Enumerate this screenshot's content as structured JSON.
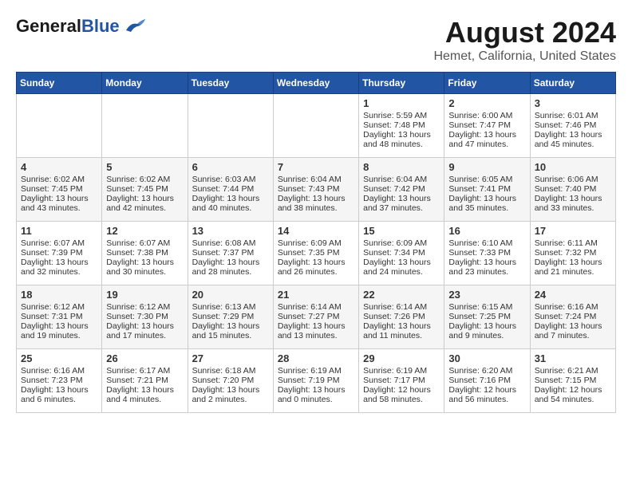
{
  "header": {
    "logo_line1": "General",
    "logo_line2": "Blue",
    "title": "August 2024",
    "subtitle": "Hemet, California, United States"
  },
  "days_of_week": [
    "Sunday",
    "Monday",
    "Tuesday",
    "Wednesday",
    "Thursday",
    "Friday",
    "Saturday"
  ],
  "weeks": [
    [
      {
        "day": "",
        "content": ""
      },
      {
        "day": "",
        "content": ""
      },
      {
        "day": "",
        "content": ""
      },
      {
        "day": "",
        "content": ""
      },
      {
        "day": "1",
        "content": "Sunrise: 5:59 AM\nSunset: 7:48 PM\nDaylight: 13 hours\nand 48 minutes."
      },
      {
        "day": "2",
        "content": "Sunrise: 6:00 AM\nSunset: 7:47 PM\nDaylight: 13 hours\nand 47 minutes."
      },
      {
        "day": "3",
        "content": "Sunrise: 6:01 AM\nSunset: 7:46 PM\nDaylight: 13 hours\nand 45 minutes."
      }
    ],
    [
      {
        "day": "4",
        "content": "Sunrise: 6:02 AM\nSunset: 7:45 PM\nDaylight: 13 hours\nand 43 minutes."
      },
      {
        "day": "5",
        "content": "Sunrise: 6:02 AM\nSunset: 7:45 PM\nDaylight: 13 hours\nand 42 minutes."
      },
      {
        "day": "6",
        "content": "Sunrise: 6:03 AM\nSunset: 7:44 PM\nDaylight: 13 hours\nand 40 minutes."
      },
      {
        "day": "7",
        "content": "Sunrise: 6:04 AM\nSunset: 7:43 PM\nDaylight: 13 hours\nand 38 minutes."
      },
      {
        "day": "8",
        "content": "Sunrise: 6:04 AM\nSunset: 7:42 PM\nDaylight: 13 hours\nand 37 minutes."
      },
      {
        "day": "9",
        "content": "Sunrise: 6:05 AM\nSunset: 7:41 PM\nDaylight: 13 hours\nand 35 minutes."
      },
      {
        "day": "10",
        "content": "Sunrise: 6:06 AM\nSunset: 7:40 PM\nDaylight: 13 hours\nand 33 minutes."
      }
    ],
    [
      {
        "day": "11",
        "content": "Sunrise: 6:07 AM\nSunset: 7:39 PM\nDaylight: 13 hours\nand 32 minutes."
      },
      {
        "day": "12",
        "content": "Sunrise: 6:07 AM\nSunset: 7:38 PM\nDaylight: 13 hours\nand 30 minutes."
      },
      {
        "day": "13",
        "content": "Sunrise: 6:08 AM\nSunset: 7:37 PM\nDaylight: 13 hours\nand 28 minutes."
      },
      {
        "day": "14",
        "content": "Sunrise: 6:09 AM\nSunset: 7:35 PM\nDaylight: 13 hours\nand 26 minutes."
      },
      {
        "day": "15",
        "content": "Sunrise: 6:09 AM\nSunset: 7:34 PM\nDaylight: 13 hours\nand 24 minutes."
      },
      {
        "day": "16",
        "content": "Sunrise: 6:10 AM\nSunset: 7:33 PM\nDaylight: 13 hours\nand 23 minutes."
      },
      {
        "day": "17",
        "content": "Sunrise: 6:11 AM\nSunset: 7:32 PM\nDaylight: 13 hours\nand 21 minutes."
      }
    ],
    [
      {
        "day": "18",
        "content": "Sunrise: 6:12 AM\nSunset: 7:31 PM\nDaylight: 13 hours\nand 19 minutes."
      },
      {
        "day": "19",
        "content": "Sunrise: 6:12 AM\nSunset: 7:30 PM\nDaylight: 13 hours\nand 17 minutes."
      },
      {
        "day": "20",
        "content": "Sunrise: 6:13 AM\nSunset: 7:29 PM\nDaylight: 13 hours\nand 15 minutes."
      },
      {
        "day": "21",
        "content": "Sunrise: 6:14 AM\nSunset: 7:27 PM\nDaylight: 13 hours\nand 13 minutes."
      },
      {
        "day": "22",
        "content": "Sunrise: 6:14 AM\nSunset: 7:26 PM\nDaylight: 13 hours\nand 11 minutes."
      },
      {
        "day": "23",
        "content": "Sunrise: 6:15 AM\nSunset: 7:25 PM\nDaylight: 13 hours\nand 9 minutes."
      },
      {
        "day": "24",
        "content": "Sunrise: 6:16 AM\nSunset: 7:24 PM\nDaylight: 13 hours\nand 7 minutes."
      }
    ],
    [
      {
        "day": "25",
        "content": "Sunrise: 6:16 AM\nSunset: 7:23 PM\nDaylight: 13 hours\nand 6 minutes."
      },
      {
        "day": "26",
        "content": "Sunrise: 6:17 AM\nSunset: 7:21 PM\nDaylight: 13 hours\nand 4 minutes."
      },
      {
        "day": "27",
        "content": "Sunrise: 6:18 AM\nSunset: 7:20 PM\nDaylight: 13 hours\nand 2 minutes."
      },
      {
        "day": "28",
        "content": "Sunrise: 6:19 AM\nSunset: 7:19 PM\nDaylight: 13 hours\nand 0 minutes."
      },
      {
        "day": "29",
        "content": "Sunrise: 6:19 AM\nSunset: 7:17 PM\nDaylight: 12 hours\nand 58 minutes."
      },
      {
        "day": "30",
        "content": "Sunrise: 6:20 AM\nSunset: 7:16 PM\nDaylight: 12 hours\nand 56 minutes."
      },
      {
        "day": "31",
        "content": "Sunrise: 6:21 AM\nSunset: 7:15 PM\nDaylight: 12 hours\nand 54 minutes."
      }
    ]
  ]
}
